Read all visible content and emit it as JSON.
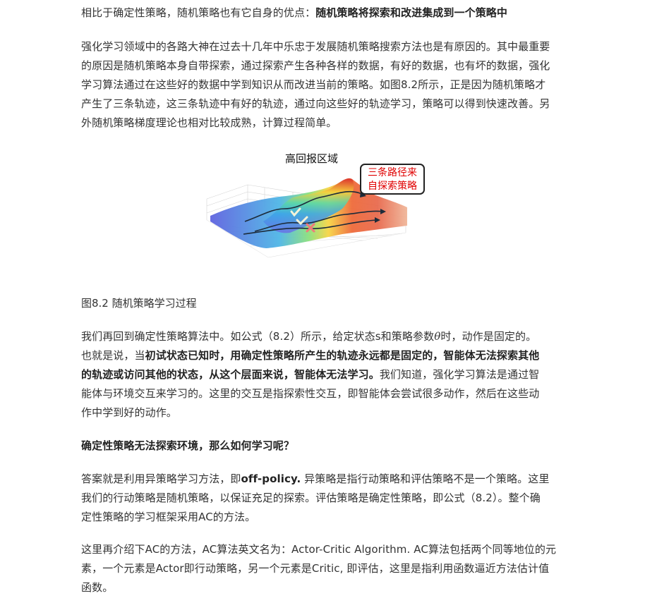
{
  "p1": {
    "lead": "相比于确定性策略，随机策略也有它自身的优点：",
    "bold": "随机策略将探索和改进集成到一个策略中"
  },
  "p2": {
    "text": "强化学习领域中的各路大神在过去十几年中乐忠于发展随机策略搜索方法也是有原因的。其中最重要的原因是随机策略本身自带探索，通过探索产生各种各样的数据，有好的数据，也有坏的数据，强化学习算法通过在这些好的数据中学到知识从而改进当前的策略。如图8.2所示，正是因为随机策略才产生了三条轨迹，这三条轨迹中有好的轨迹，通过向这些好的轨迹学习，策略可以得到快速改善。另外随机策略梯度理论也相对比较成熟，计算过程简单。"
  },
  "figure": {
    "title": "高回报区域",
    "callout_line1": "三条路径来",
    "callout_line2": "自探索策略",
    "caption": "图8.2 随机策略学习过程"
  },
  "p3": {
    "t1": "我们再回到确定性策略算法中。如公式（8.2）所示，给定状态s和策略参数",
    "theta": "θ",
    "t2": "时，动作是固定的。也就是说，当",
    "bold": "初试状态已知时，用确定性策略所产生的轨迹永远都是固定的，智能体无法探索其他的轨迹或访问其他的状态，从这个层面来说，智能体无法学习。",
    "t3": "我们知道，强化学习算法是通过智能体与环境交互来学习的。这里的交互是指探索性交互，即智能体会尝试很多动作，然后在这些动作中学到好的动作。"
  },
  "p4": {
    "bold": "确定性策略无法探索环境，那么如何学习呢？"
  },
  "p5": {
    "t1": "答案就是利用异策略学习方法，即",
    "bold": "off-policy.",
    "t2": " 异策略是指行动策略和评估策略不是一个策略。这里我们的行动策略是随机策略，以保证充足的探索。评估策略是确定性策略，即公式（8.2）。整个确定性策略的学习框架采用AC的方法。"
  },
  "p6": {
    "text": "这里再介绍下AC的方法，AC算法英文名为：Actor-Critic Algorithm. AC算法包括两个同等地位的元素，一个元素是Actor即行动策略，另一个元素是Critic, 即评估，这里是指利用函数逼近方法估计值函数。"
  }
}
